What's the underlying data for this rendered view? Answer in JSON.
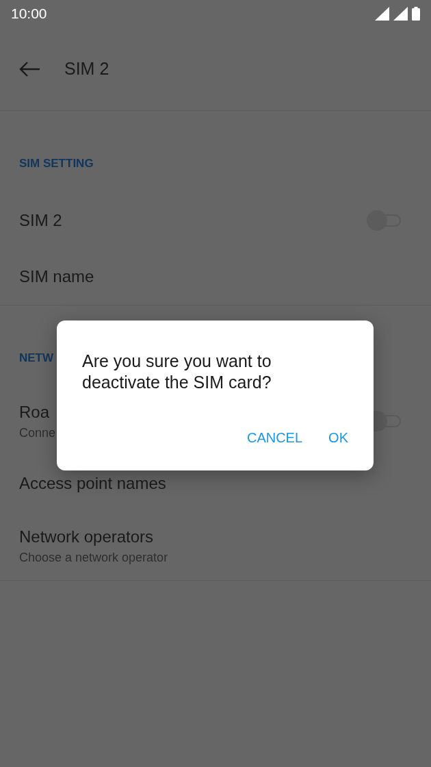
{
  "status_bar": {
    "time": "10:00"
  },
  "toolbar": {
    "title": "SIM 2"
  },
  "sections": [
    {
      "header": "SIM SETTING",
      "items": [
        {
          "kind": "toggle",
          "title": "SIM 2",
          "on": false
        },
        {
          "kind": "plain",
          "title": "SIM name"
        }
      ]
    },
    {
      "header": "NETW",
      "items": [
        {
          "kind": "toggle",
          "title": "Roa",
          "subtitle": "Conne",
          "on": false
        },
        {
          "kind": "plain",
          "title": "Access point names"
        },
        {
          "kind": "plain",
          "title": "Network operators",
          "subtitle": "Choose a network operator"
        }
      ]
    }
  ],
  "dialog": {
    "message": "Are you sure you want to deactivate the SIM card?",
    "buttons": [
      "CANCEL",
      "OK"
    ]
  }
}
